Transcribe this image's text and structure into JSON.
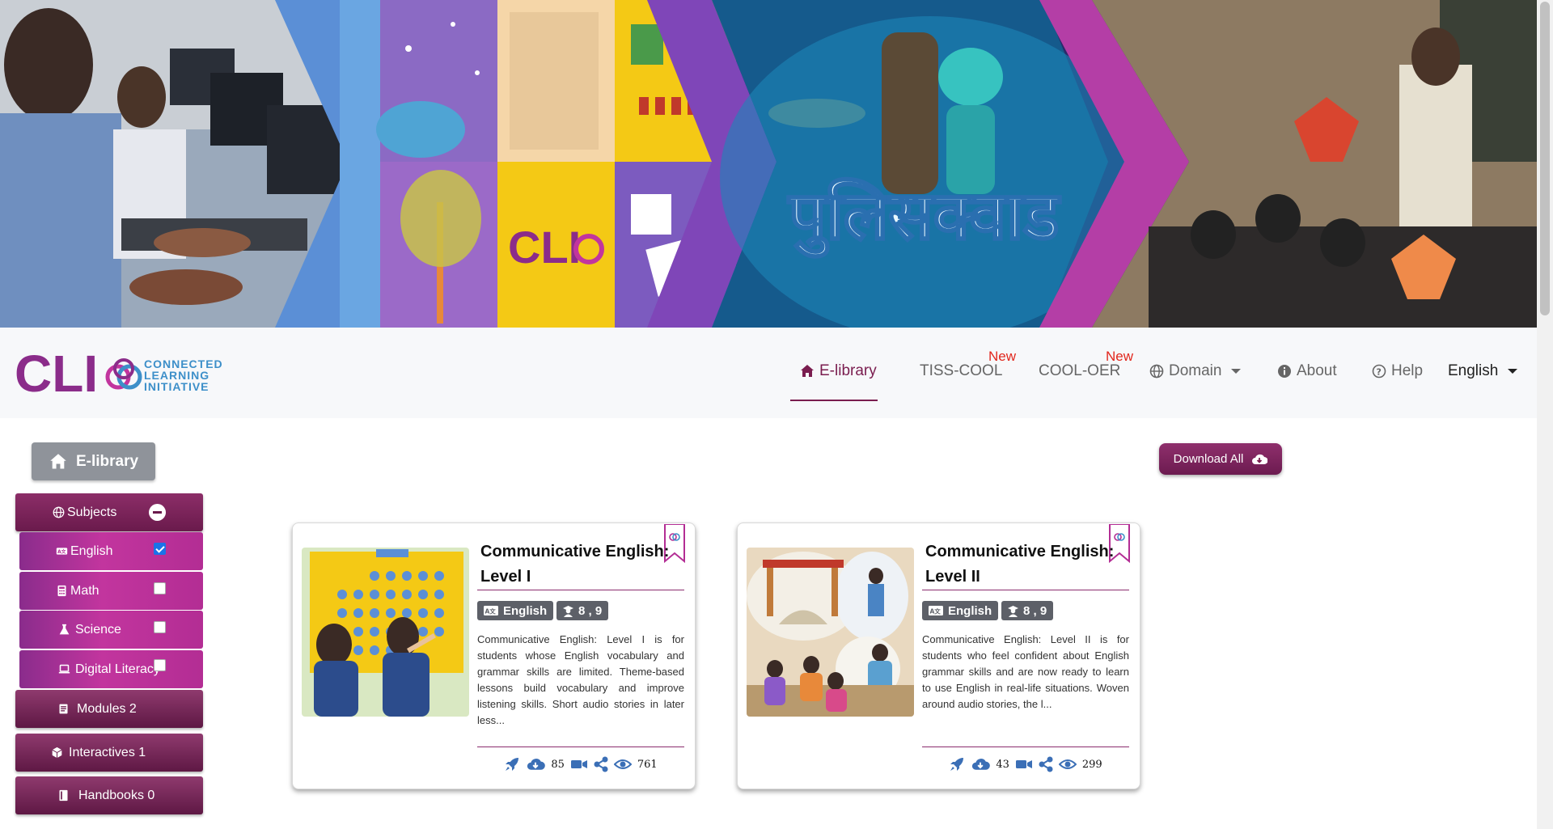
{
  "banner": {
    "hindi_title": "पुलिसक्वाड",
    "logo_text": "CLI"
  },
  "brand": {
    "logo_text": "CLI",
    "line1": "CONNECTED",
    "line2": "LEARNING",
    "line3": "INITIATIVE"
  },
  "nav": {
    "elibrary": "E-library",
    "tiss_cool": "TISS-COOL",
    "cool_oer": "COOL-OER",
    "new_badge": "New",
    "domain": "Domain",
    "about": "About",
    "help": "Help",
    "language": "English"
  },
  "sidebar": {
    "home": "E-library",
    "subjects": "Subjects",
    "items": [
      {
        "label": "English",
        "checked": true
      },
      {
        "label": "Math",
        "checked": false
      },
      {
        "label": "Science",
        "checked": false
      },
      {
        "label": "Digital Literacy",
        "checked": false
      }
    ],
    "modules": "Modules 2",
    "interactives": "Interactives 1",
    "handbooks": "Handbooks 0"
  },
  "download_all": "Download All",
  "cards": [
    {
      "title_line1": "Communicative English:",
      "title_line2": "Level I",
      "subject": "English",
      "grades": "8 , 9",
      "description": "Communicative English: Level I is for students whose English vocabulary and grammar skills are limited. Theme-based lessons build vocabulary and improve listening skills. Short audio stories in later less...",
      "downloads": "85",
      "views": "761"
    },
    {
      "title_line1": "Communicative English:",
      "title_line2": "Level II",
      "subject": "English",
      "grades": "8 , 9",
      "description": "Communicative English: Level II is for students who feel confident about English grammar skills and are now ready to learn to use English in real-life situations. Woven around audio stories, the l...",
      "downloads": "43",
      "views": "299"
    }
  ],
  "colors": {
    "brand_purple": "#7a1d4f",
    "sidebar_magenta": "#c2359e",
    "new_red": "#e1261c",
    "icon_blue": "#3b6fb6"
  }
}
